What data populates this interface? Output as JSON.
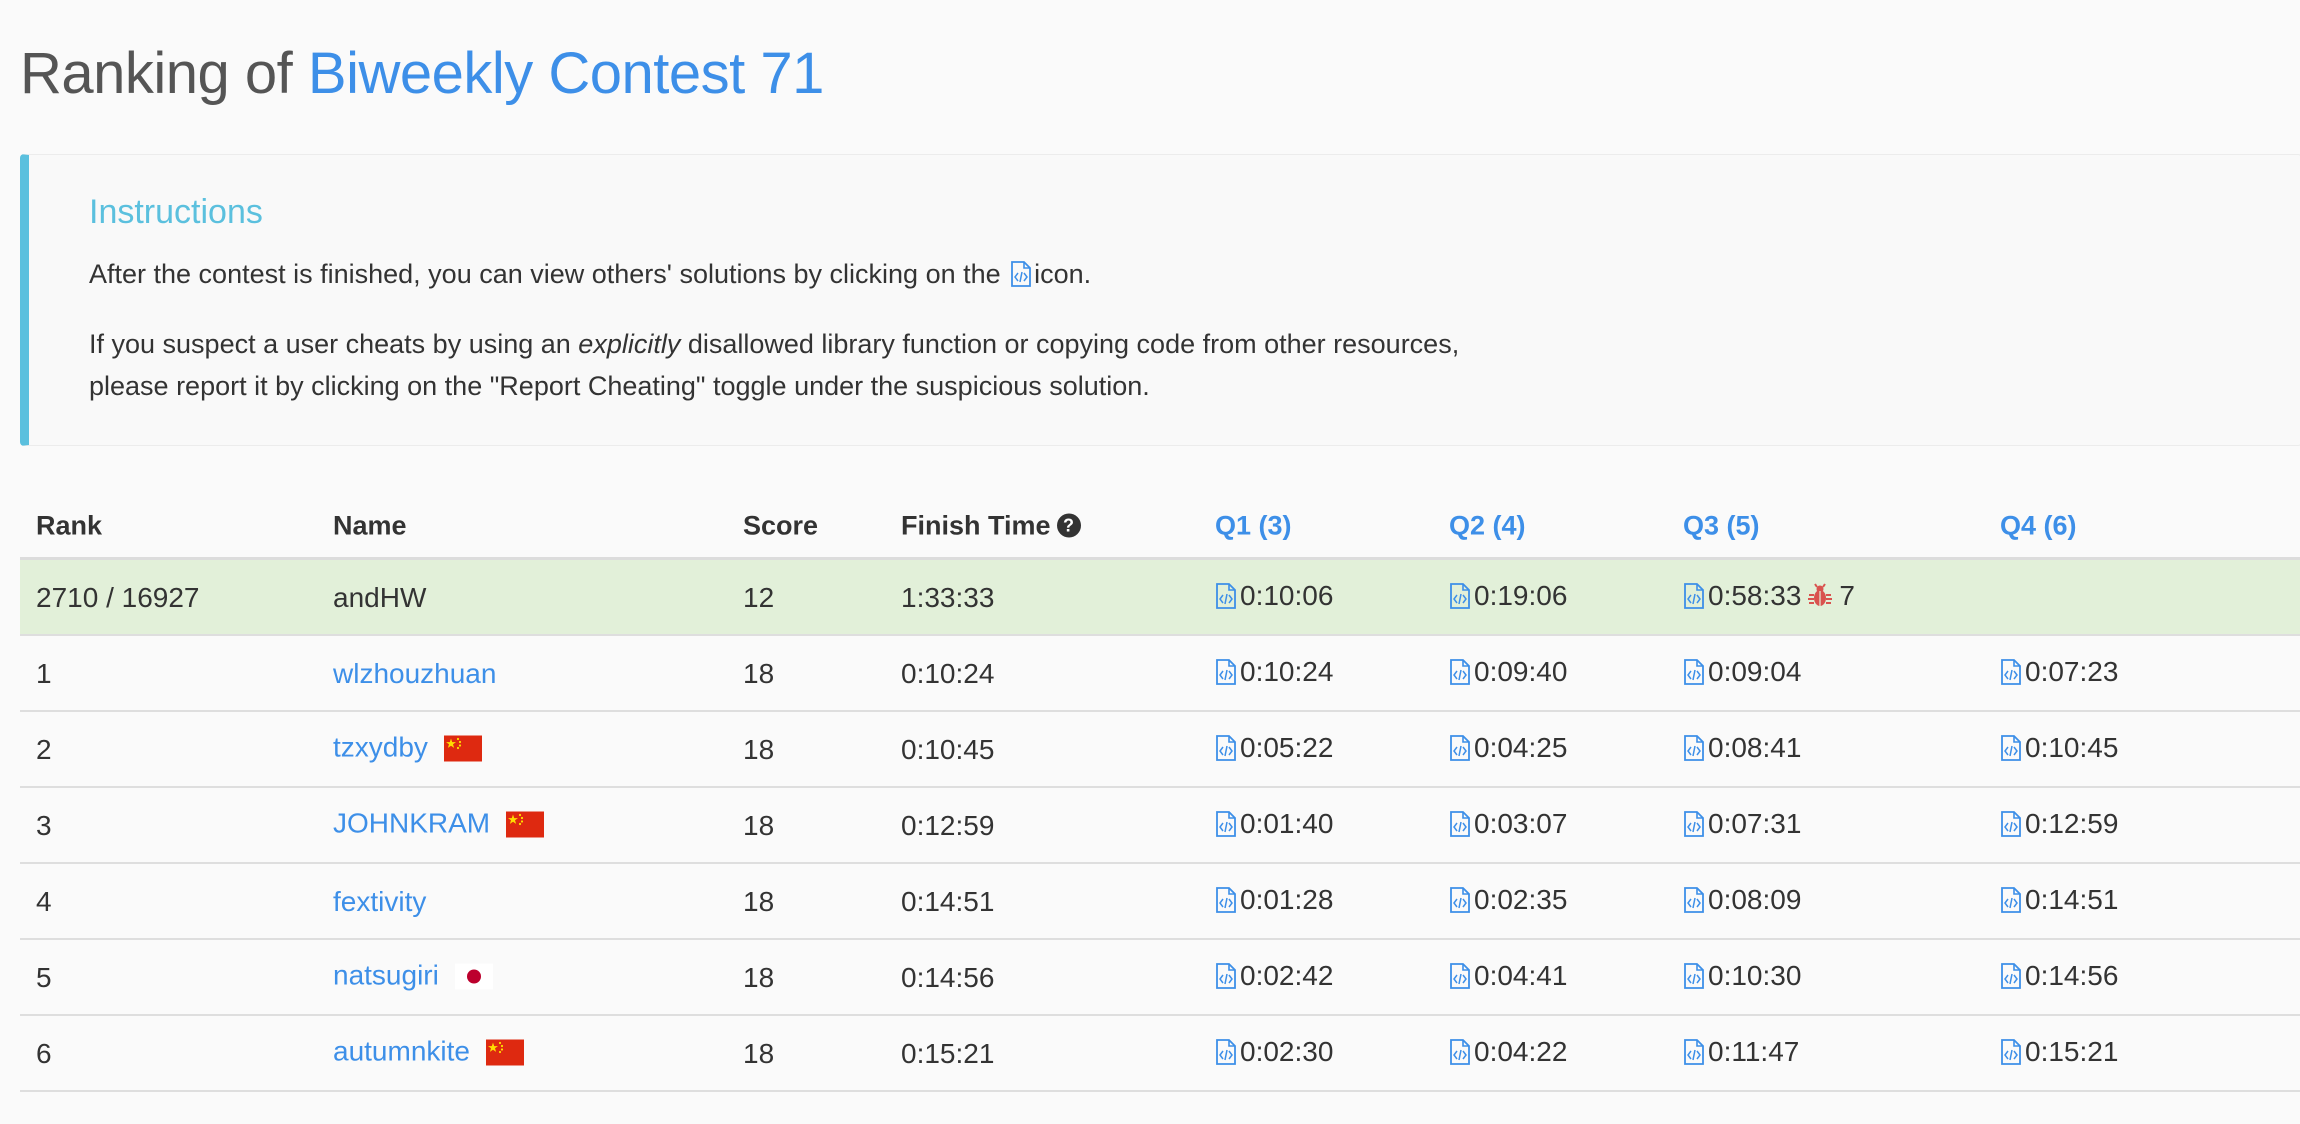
{
  "title": {
    "prefix": "Ranking of ",
    "contest_name": "Biweekly Contest 71"
  },
  "instructions": {
    "heading": "Instructions",
    "para1_before": "After the contest is finished, you can view others' solutions by clicking on the",
    "para1_after": "icon.",
    "para2_before": "If you suspect a user cheats by using an ",
    "para2_emphasis": "explicitly",
    "para2_after": " disallowed library function or copying code from other resources,",
    "para2_line2": "please report it by clicking on the \"Report Cheating\" toggle under the suspicious solution."
  },
  "table": {
    "headers": {
      "rank": "Rank",
      "name": "Name",
      "score": "Score",
      "finish_time": "Finish Time",
      "q1": "Q1 (3)",
      "q2": "Q2 (4)",
      "q3": "Q3 (5)",
      "q4": "Q4 (6)"
    },
    "my_row": {
      "rank": "2710 / 16927",
      "name": "andHW",
      "score": "12",
      "finish_time": "1:33:33",
      "q1": "0:10:06",
      "q2": "0:19:06",
      "q3": "0:58:33",
      "q3_bugs": "7",
      "q4": ""
    },
    "rows": [
      {
        "rank": "1",
        "name": "wlzhouzhuan",
        "flag": "",
        "score": "18",
        "finish_time": "0:10:24",
        "q1": "0:10:24",
        "q2": "0:09:40",
        "q3": "0:09:04",
        "q4": "0:07:23"
      },
      {
        "rank": "2",
        "name": "tzxydby",
        "flag": "china-flag",
        "score": "18",
        "finish_time": "0:10:45",
        "q1": "0:05:22",
        "q2": "0:04:25",
        "q3": "0:08:41",
        "q4": "0:10:45"
      },
      {
        "rank": "3",
        "name": "JOHNKRAM",
        "flag": "china-flag",
        "score": "18",
        "finish_time": "0:12:59",
        "q1": "0:01:40",
        "q2": "0:03:07",
        "q3": "0:07:31",
        "q4": "0:12:59"
      },
      {
        "rank": "4",
        "name": "fextivity",
        "flag": "",
        "score": "18",
        "finish_time": "0:14:51",
        "q1": "0:01:28",
        "q2": "0:02:35",
        "q3": "0:08:09",
        "q4": "0:14:51"
      },
      {
        "rank": "5",
        "name": "natsugiri",
        "flag": "japan-flag",
        "score": "18",
        "finish_time": "0:14:56",
        "q1": "0:02:42",
        "q2": "0:04:41",
        "q3": "0:10:30",
        "q4": "0:14:56"
      },
      {
        "rank": "6",
        "name": "autumnkite",
        "flag": "china-flag",
        "score": "18",
        "finish_time": "0:15:21",
        "q1": "0:02:30",
        "q2": "0:04:22",
        "q3": "0:11:47",
        "q4": "0:15:21"
      }
    ]
  },
  "colors": {
    "accent": "#3d8fe8",
    "info": "#5bc0de",
    "my_row_bg": "#e2f0d9",
    "bug": "#d9534f"
  }
}
